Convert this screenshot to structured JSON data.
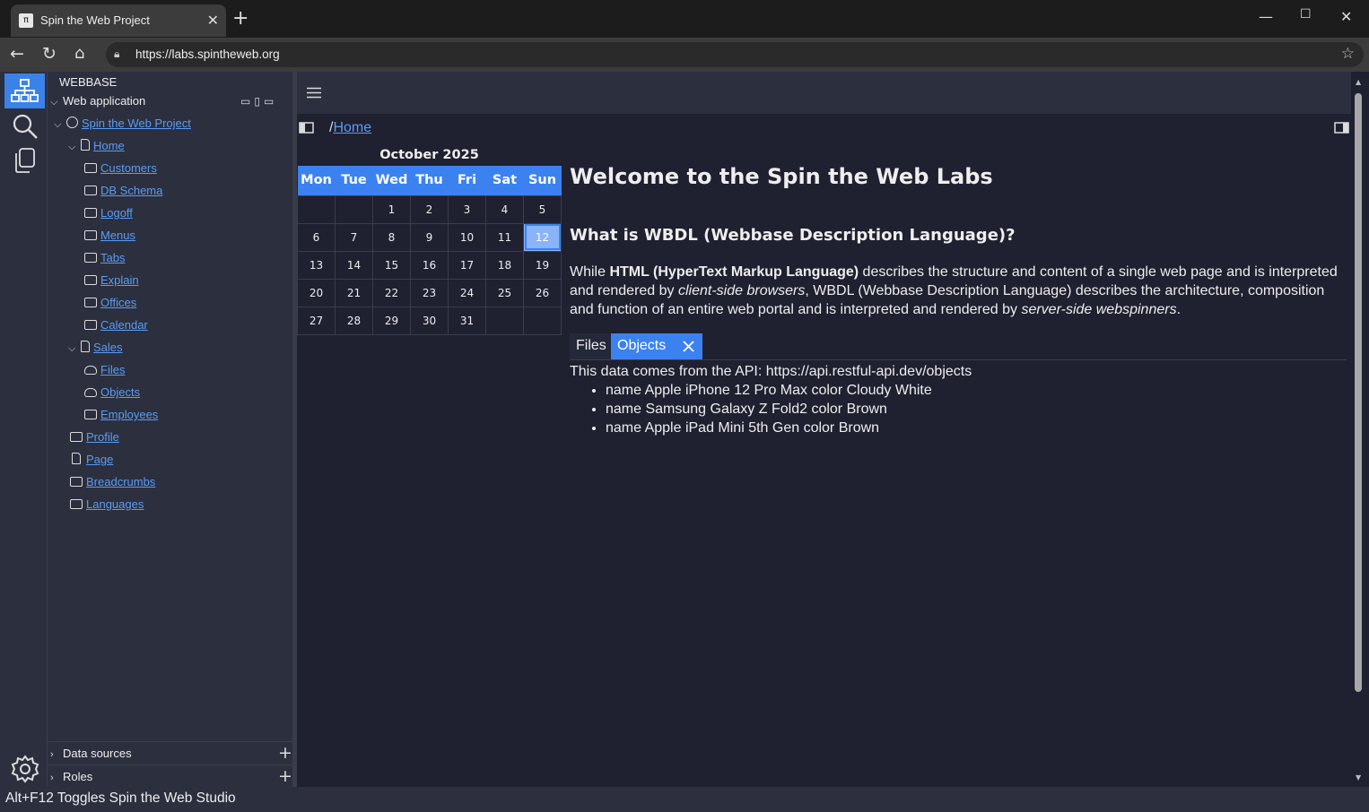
{
  "browser": {
    "tab_title": "Spin the Web Project",
    "url": "https://labs.spintheweb.org"
  },
  "sidebar": {
    "header": "WEBBASE",
    "root_label": "Web application",
    "tree": {
      "project": "Spin the Web Project",
      "home": "Home",
      "home_children": [
        "Customers",
        "DB Schema",
        "Logoff",
        "Menus",
        "Tabs",
        "Explain",
        "Offices",
        "Calendar"
      ],
      "sales": "Sales",
      "sales_children": [
        "Files",
        "Objects",
        "Employees"
      ],
      "root_children": [
        "Profile",
        "Page",
        "Breadcrumbs",
        "Languages"
      ]
    },
    "bottom_sections": [
      "Data sources",
      "Roles"
    ]
  },
  "breadcrumb": {
    "separator": "/",
    "link": "Home"
  },
  "calendar": {
    "month": "October 2025",
    "weekdays": [
      "Mon",
      "Tue",
      "Wed",
      "Thu",
      "Fri",
      "Sat",
      "Sun"
    ],
    "weeks": [
      [
        "",
        "",
        "1",
        "2",
        "3",
        "4",
        "5"
      ],
      [
        "6",
        "7",
        "8",
        "9",
        "10",
        "11",
        "12"
      ],
      [
        "13",
        "14",
        "15",
        "16",
        "17",
        "18",
        "19"
      ],
      [
        "20",
        "21",
        "22",
        "23",
        "24",
        "25",
        "26"
      ],
      [
        "27",
        "28",
        "29",
        "30",
        "31",
        "",
        ""
      ]
    ],
    "selected_day": "12"
  },
  "content": {
    "title": "Welcome to the Spin the Web Labs",
    "subtitle": "What is WBDL (Webbase Description Language)?",
    "desc_1": "While ",
    "desc_html": "HTML (HyperText Markup Language)",
    "desc_2": " describes the structure and content of a single web page and is interpreted and rendered by ",
    "desc_client": "client-side browsers",
    "desc_3": ", WBDL (Webbase Description Language) describes the architecture, composition and function of an entire web portal and is interpreted and rendered by ",
    "desc_server": "server-side webspinners",
    "desc_4": ".",
    "tabs": [
      "Files",
      "Objects"
    ],
    "active_tab": "Objects",
    "api_text": "This data comes from the API: https://api.restful-api.dev/objects",
    "items": [
      "name Apple iPhone 12 Pro Max color Cloudy White",
      "name Samsung Galaxy Z Fold2 color Brown",
      "name Apple iPad Mini 5th Gen color Brown"
    ]
  },
  "status_bar": "Alt+F12 Toggles Spin the Web Studio",
  "colors": {
    "accent": "#3b82f0",
    "link": "#5b9cf3",
    "panel": "#2b2f3e",
    "background": "#1f2030"
  }
}
